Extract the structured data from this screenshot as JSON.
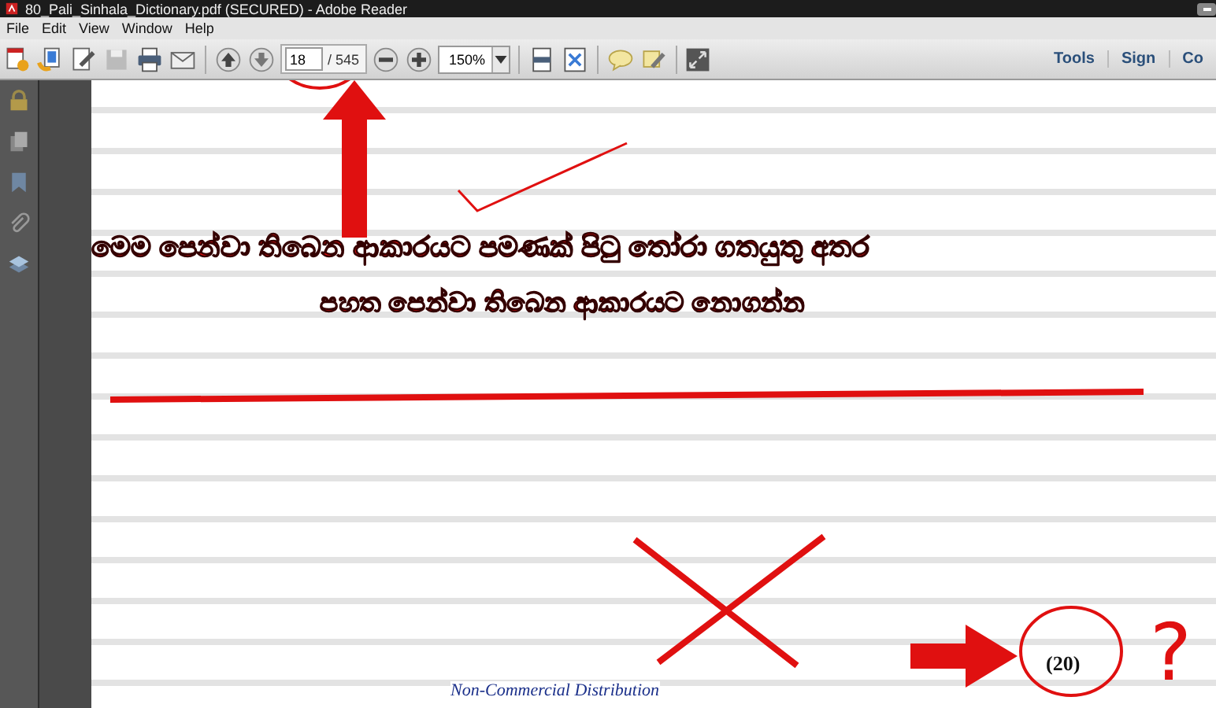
{
  "window": {
    "title": "80_Pali_Sinhala_Dictionary.pdf (SECURED) - Adobe Reader"
  },
  "menu": [
    "File",
    "Edit",
    "View",
    "Window",
    "Help"
  ],
  "toolbar": {
    "page_number": "18",
    "page_count": "/ 545",
    "zoom": "150%",
    "right_buttons": [
      "Tools",
      "Sign",
      "Co"
    ]
  },
  "document": {
    "footer": "Non-Commercial Distribution",
    "page_label": "(20)"
  },
  "annotation": {
    "caption": [
      "මෙම පෙන්වා තිබෙන ආකාරයට පමණක් පිටු තෝරා ගතයුතු අතර",
      "පහත පෙන්වා තිබෙන ආකාරයට නොගන්න"
    ],
    "mark": "?"
  }
}
